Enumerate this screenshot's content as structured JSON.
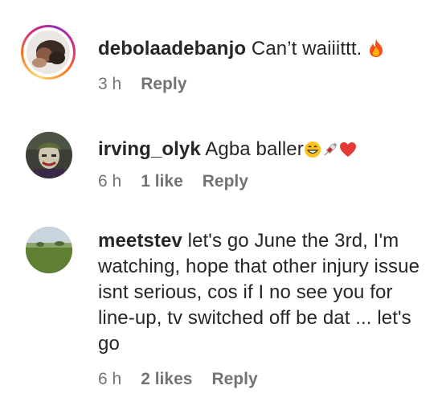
{
  "comments": [
    {
      "username": "debolaadebanjo",
      "text": "Can’t waiiittt.",
      "emoji": [
        "fire-emoji"
      ],
      "time": "3 h",
      "likes": "",
      "reply_label": "Reply",
      "has_story_ring": true
    },
    {
      "username": "irving_olyk",
      "text": "Agba baller",
      "emoji": [
        "grin-emoji",
        "syringe-emoji",
        "red-heart-emoji"
      ],
      "time": "6 h",
      "likes": "1 like",
      "reply_label": "Reply",
      "has_story_ring": false
    },
    {
      "username": "meetstev",
      "text": "let's go June the 3rd, I'm watching, hope that other injury issue isnt serious, cos if I no see you for line-up, tv switched off be dat ... let's go",
      "emoji": [],
      "time": "6 h",
      "likes": "2 likes",
      "reply_label": "Reply",
      "has_story_ring": false
    }
  ],
  "colors": {
    "text": "#262626",
    "meta": "#737373",
    "ring_start": "#feda75",
    "ring_mid": "#d62976",
    "ring_end": "#962fbf"
  }
}
